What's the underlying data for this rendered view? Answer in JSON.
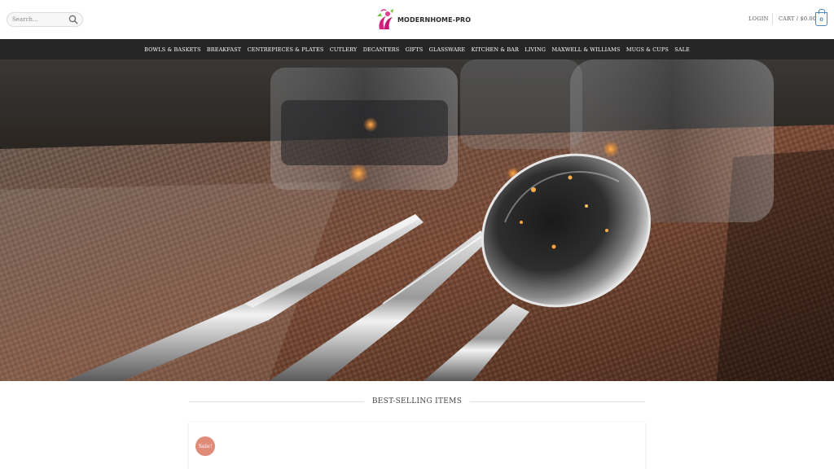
{
  "header": {
    "search_placeholder": "Search...",
    "logo_text": "MODERNHOME-PRO",
    "login_label": "LOGIN",
    "cart_label": "CART / $0.00",
    "cart_count": "0"
  },
  "nav": {
    "items": [
      "BOWLS & BASKETS",
      "BREAKFAST",
      "CENTREPIECES & PLATES",
      "CUTLERY",
      "DECANTERS",
      "GIFTS",
      "GLASSWARE",
      "KITCHEN & BAR",
      "LIVING",
      "MAXWELL & WILLIAMS",
      "MUGS & CUPS",
      "SALE"
    ]
  },
  "slider": {
    "slides_count": 2,
    "active_slide": 1
  },
  "best_selling": {
    "title": "BEST-SELLING ITEMS",
    "sale_badge": "Sale!"
  },
  "colors": {
    "nav_bg": "#262626",
    "accent_blue": "#4a8ac4",
    "sale_badge": "#e08a79",
    "logo_pink": "#d6217f"
  },
  "icons": {
    "search": "search-icon",
    "logo": "logo-mark-icon"
  }
}
